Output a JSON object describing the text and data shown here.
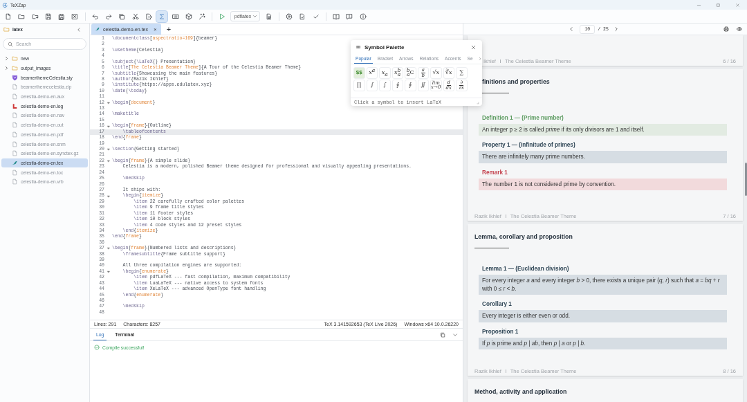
{
  "window": {
    "title": "TeXZap"
  },
  "toolbar": {
    "symbol_palette_on": true,
    "groups": [
      [
        {
          "kind": "button"
        },
        {
          "kind": "button"
        },
        {
          "kind": "button"
        },
        {
          "kind": "button"
        },
        {
          "kind": "button"
        },
        {
          "kind": "button"
        }
      ],
      [
        {
          "kind": "button"
        },
        {
          "kind": "button"
        },
        {
          "kind": "button"
        },
        {
          "kind": "button"
        },
        {
          "kind": "button"
        },
        {
          "kind": "button"
        },
        {
          "kind": "button"
        },
        {
          "kind": "button"
        },
        {
          "kind": "button"
        }
      ],
      [
        {
          "kind": "button"
        },
        {
          "kind": "select",
          "value": "pdflatex"
        },
        {
          "kind": "button"
        }
      ],
      [
        {
          "kind": "button"
        },
        {
          "kind": "button"
        },
        {
          "kind": "button"
        }
      ],
      [
        {
          "kind": "button"
        },
        {
          "kind": "button"
        },
        {
          "kind": "button"
        }
      ]
    ]
  },
  "sidebar": {
    "folder": "latex",
    "search": {
      "placeholder": "Search"
    },
    "items": [
      {
        "kind": "folder",
        "label": "new",
        "expanded": false,
        "selected": false,
        "muted": false
      },
      {
        "kind": "folder",
        "label": "output_images",
        "expanded": false,
        "selected": false,
        "muted": false
      },
      {
        "kind": "style",
        "label": "beamerthemeCelestia.sty",
        "selected": false,
        "muted": false
      },
      {
        "kind": "file",
        "label": "beamerthemecelestia.zip",
        "selected": false,
        "muted": true
      },
      {
        "kind": "file",
        "label": "celestia-demo-en.aux",
        "selected": false,
        "muted": true
      },
      {
        "kind": "log",
        "label": "celestia-demo-en.log",
        "selected": false,
        "muted": false
      },
      {
        "kind": "file",
        "label": "celestia-demo-en.nav",
        "selected": false,
        "muted": true
      },
      {
        "kind": "file",
        "label": "celestia-demo-en.out",
        "selected": false,
        "muted": true
      },
      {
        "kind": "file",
        "label": "celestia-demo-en.pdf",
        "selected": false,
        "muted": true
      },
      {
        "kind": "file",
        "label": "celestia-demo-en.snm",
        "selected": false,
        "muted": true
      },
      {
        "kind": "file",
        "label": "celestia-demo-en.synctex.gz",
        "selected": false,
        "muted": true
      },
      {
        "kind": "tex",
        "label": "celestia-demo-en.tex",
        "selected": true,
        "muted": false
      },
      {
        "kind": "file",
        "label": "celestia-demo-en.toc",
        "selected": false,
        "muted": true
      },
      {
        "kind": "file",
        "label": "celestia-demo-en.vrb",
        "selected": false,
        "muted": true
      }
    ]
  },
  "editor": {
    "tabs": [
      {
        "label": "celestia-demo-en.tex",
        "close": "×",
        "selected": true
      }
    ],
    "add_tab": "+",
    "lines": [
      {
        "n": "1",
        "text": "\\documentclass[aspectratio=169]{beamer}",
        "fold": false,
        "current": false
      },
      {
        "n": "2",
        "fold": false,
        "current": false
      },
      {
        "n": "3",
        "text": "\\usetheme{Celestia}",
        "fold": false,
        "current": false
      },
      {
        "n": "4",
        "fold": false,
        "current": false
      },
      {
        "n": "5",
        "text": "\\subject{\\LaTeX{} Presentation}",
        "fold": false,
        "current": false
      },
      {
        "n": "6",
        "text": "\\title[The Celestia Beamer Theme]{A Tour of the Celestia Beamer Theme}",
        "fold": false,
        "current": false
      },
      {
        "n": "7",
        "text": "\\subtitle{Showcasing the main features}",
        "fold": false,
        "current": false
      },
      {
        "n": "8",
        "text": "\\author{Razik Ikhlef}",
        "fold": false,
        "current": false
      },
      {
        "n": "9",
        "text": "\\institute{https://apps.edulatex.xyz}",
        "fold": false,
        "current": false
      },
      {
        "n": "10",
        "text": "\\date{\\today}",
        "fold": false,
        "current": false
      },
      {
        "n": "11",
        "fold": false,
        "current": false
      },
      {
        "n": "12",
        "text": "\\begin{document}",
        "fold": true,
        "current": false
      },
      {
        "n": "13",
        "fold": false,
        "current": false
      },
      {
        "n": "14",
        "text": "\\maketitle",
        "fold": false,
        "current": false
      },
      {
        "n": "15",
        "fold": false,
        "current": false
      },
      {
        "n": "16",
        "text": "\\begin{frame}{Outline}",
        "fold": true,
        "current": false
      },
      {
        "n": "17",
        "text": "    \\tableofcontents",
        "fold": false,
        "current": true
      },
      {
        "n": "18",
        "text": "\\end{frame}",
        "fold": false,
        "current": false
      },
      {
        "n": "19",
        "fold": false,
        "current": false
      },
      {
        "n": "20",
        "text": "\\section{Getting started}",
        "fold": true,
        "current": false
      },
      {
        "n": "21",
        "fold": false,
        "current": false
      },
      {
        "n": "22",
        "text": "\\begin{frame}{A simple slide}",
        "fold": true,
        "current": false
      },
      {
        "n": "23",
        "text": "    Celestia is a modern, polished Beamer theme designed for professional and visually appealing presentations.",
        "fold": false,
        "current": false
      },
      {
        "n": "24",
        "fold": false,
        "current": false
      },
      {
        "n": "25",
        "text": "    \\medskip",
        "fold": false,
        "current": false
      },
      {
        "n": "26",
        "fold": false,
        "current": false
      },
      {
        "n": "27",
        "text": "    It ships with:",
        "fold": false,
        "current": false
      },
      {
        "n": "28",
        "text": "    \\begin{itemize}",
        "fold": true,
        "current": false
      },
      {
        "n": "29",
        "text": "        \\item 22 carefully crafted color palettes",
        "fold": false,
        "current": false
      },
      {
        "n": "30",
        "text": "        \\item 9 frame title styles",
        "fold": false,
        "current": false
      },
      {
        "n": "31",
        "text": "        \\item 11 footer styles",
        "fold": false,
        "current": false
      },
      {
        "n": "32",
        "text": "        \\item 10 block styles",
        "fold": false,
        "current": false
      },
      {
        "n": "33",
        "text": "        \\item 4 code styles and 12 preset styles",
        "fold": false,
        "current": false
      },
      {
        "n": "34",
        "text": "    \\end{itemize}",
        "fold": false,
        "current": false
      },
      {
        "n": "35",
        "text": "\\end{frame}",
        "fold": false,
        "current": false
      },
      {
        "n": "36",
        "fold": false,
        "current": false
      },
      {
        "n": "37",
        "text": "\\begin{frame}{Numbered lists and descriptions}",
        "fold": true,
        "current": false
      },
      {
        "n": "38",
        "text": "    \\framesubtitle{Frame subtitle support}",
        "fold": false,
        "current": false
      },
      {
        "n": "39",
        "fold": false,
        "current": false
      },
      {
        "n": "40",
        "text": "    All three compilation engines are supported:",
        "fold": false,
        "current": false
      },
      {
        "n": "41",
        "text": "    \\begin{enumerate}",
        "fold": true,
        "current": false
      },
      {
        "n": "42",
        "text": "        \\item pdfLaTeX --- fast compilation, maximum compatibility",
        "fold": false,
        "current": false
      },
      {
        "n": "43",
        "text": "        \\item LuaLaTeX --- native access to system fonts",
        "fold": false,
        "current": false
      },
      {
        "n": "44",
        "text": "        \\item XeLaTeX --- advanced OpenType font handling",
        "fold": false,
        "current": false
      },
      {
        "n": "45",
        "text": "    \\end{enumerate}",
        "fold": false,
        "current": false
      },
      {
        "n": "46",
        "fold": false,
        "current": false
      },
      {
        "n": "47",
        "text": "    \\medskip",
        "fold": false,
        "current": false
      },
      {
        "n": "48",
        "fold": false,
        "current": false
      }
    ],
    "status_bar": {
      "lines": "Lines: 291",
      "characters": "Characters: 8257",
      "engine_version": "TeX 3.141592653 (TeX Live 2026)",
      "system": "Windows x64 10.0.26220"
    }
  },
  "output": {
    "tabs": [
      {
        "label": "Log",
        "selected": true
      },
      {
        "label": "Terminal",
        "selected": false
      }
    ],
    "message": {
      "text": "Compile successful!"
    }
  },
  "symbol_palette": {
    "title": "Symbol Palette",
    "tabs": [
      {
        "label": "Popular",
        "selected": true
      },
      {
        "label": "Bracket",
        "selected": false
      },
      {
        "label": "Arrows",
        "selected": false
      },
      {
        "label": "Relations",
        "selected": false
      },
      {
        "label": "Accents",
        "selected": false
      },
      {
        "label": "Se",
        "selected": false
      }
    ],
    "symbols": [
      {
        "kind": "text",
        "text": "$$",
        "selected": true
      },
      {
        "kind": "script",
        "base": "x",
        "sup": "a",
        "selected": false
      },
      {
        "kind": "script",
        "base": "x",
        "sub": "a",
        "selected": false
      },
      {
        "kind": "script",
        "base": "x",
        "sup": "b",
        "sub": "a",
        "selected": false
      },
      {
        "kind": "prescript",
        "base": "C",
        "sup": "b",
        "sub": "a",
        "selected": false
      },
      {
        "kind": "stack",
        "top": "a",
        "bottom": "b",
        "bar": true,
        "selected": false
      },
      {
        "kind": "text",
        "text": "√*x*",
        "selected": false
      },
      {
        "kind": "text",
        "text": "∛*x*",
        "selected": false
      },
      {
        "kind": "text",
        "text": "∑",
        "selected": false
      },
      {
        "kind": "text",
        "text": "∏",
        "selected": false
      },
      {
        "kind": "text",
        "text": "∫",
        "selected": false
      },
      {
        "kind": "text",
        "text": "∫",
        "selected": false
      },
      {
        "kind": "text",
        "text": "∮",
        "selected": false
      },
      {
        "kind": "text",
        "text": "∮",
        "selected": false
      },
      {
        "kind": "text",
        "text": "∬",
        "selected": false
      },
      {
        "kind": "stack",
        "top": "lim",
        "bottom": "x→0",
        "bar": false,
        "selected": false
      },
      {
        "kind": "stack",
        "top": "d",
        "bottom": "dx",
        "bar": true,
        "selected": false
      },
      {
        "kind": "stack",
        "top": "∂",
        "bottom": "∂x",
        "bar": true,
        "selected": false
      }
    ],
    "hint": "Click a symbol to insert LaTeX"
  },
  "preview": {
    "page": "10",
    "page_count": "/ 25",
    "slides": [
      {
        "footer": {
          "author": "Ikhlef",
          "title": "The Celestia Beamer Theme",
          "page": "6 / 16",
          "covered": true
        }
      },
      {
        "title": "finitions and properties",
        "title_covered": true,
        "blocks": [
          {
            "kind": "definition",
            "title": "Definition 1 — (Prime number)",
            "body": "An integer p ≥ 2 is called *prime* if its only divisors are 1 and itself."
          },
          {
            "kind": "property",
            "title": "Property 1 — (Infinitude of primes)",
            "body": "There are infinitely many prime numbers."
          },
          {
            "kind": "remark",
            "title": "Remark 1",
            "body": "The number 1 is not considered prime by convention."
          }
        ],
        "footer": {
          "author": "Razik Ikhlef",
          "title": "The Celestia Beamer Theme",
          "page": "7 / 16"
        }
      },
      {
        "title": "Lemma, corollary and proposition",
        "blocks": [
          {
            "kind": "lemma",
            "title": "Lemma 1 — (Euclidean division)",
            "body": "For every integer *a* and every integer *b* > 0, there exists a unique pair (*q*, *r*) such that *a* = *bq* + *r* with 0 ≤ *r* < *b*."
          },
          {
            "kind": "corollary",
            "title": "Corollary 1",
            "body": "Every integer is either even or odd."
          },
          {
            "kind": "proposition",
            "title": "Proposition 1",
            "body": "If *p* is prime and *p* | *ab*, then *p* | *a* or *p* | *b*."
          }
        ],
        "footer": {
          "author": "Razik Ikhlef",
          "title": "The Celestia Beamer Theme",
          "page": "8 / 16"
        }
      },
      {
        "title": "Method, activity and application"
      }
    ]
  }
}
